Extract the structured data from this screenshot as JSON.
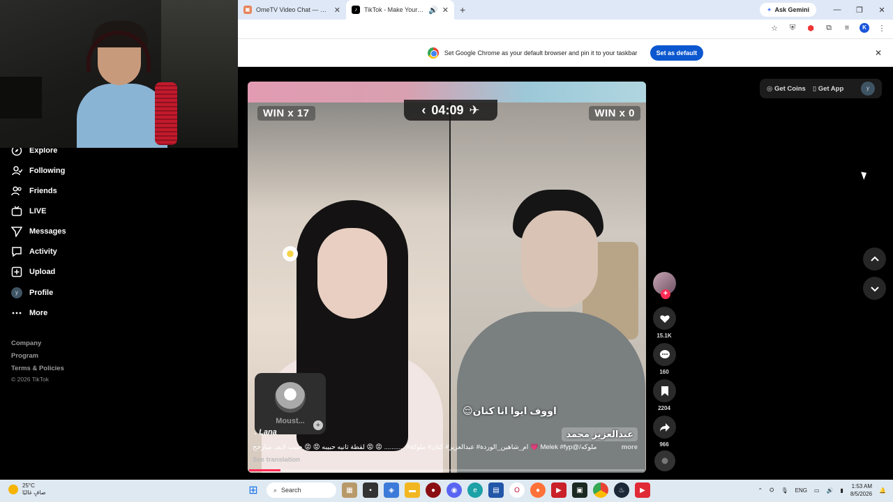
{
  "browser": {
    "tabs": [
      {
        "title": "OmeTV Video Chat — Omegle",
        "active": false
      },
      {
        "title": "TikTok - Make Your Day",
        "active": true
      }
    ],
    "ask_gemini": "Ask Gemini",
    "profile_initial": "K",
    "infobar_text": "Set Google Chrome as your default browser and pin it to your taskbar",
    "infobar_button": "Set as default"
  },
  "sidebar": {
    "items": [
      {
        "label": "Explore",
        "icon": "compass-icon"
      },
      {
        "label": "Following",
        "icon": "following-icon"
      },
      {
        "label": "Friends",
        "icon": "friends-icon"
      },
      {
        "label": "LIVE",
        "icon": "live-icon"
      },
      {
        "label": "Messages",
        "icon": "send-icon"
      },
      {
        "label": "Activity",
        "icon": "activity-icon"
      },
      {
        "label": "Upload",
        "icon": "upload-icon"
      },
      {
        "label": "Profile",
        "icon": "profile-avatar"
      },
      {
        "label": "More",
        "icon": "more-icon"
      }
    ],
    "profile_initial": "y",
    "footer": [
      "Company",
      "Program",
      "Terms & Policies"
    ],
    "copyright": "© 2026 TikTok"
  },
  "top_right": {
    "get_coins": "Get Coins",
    "get_app": "Get App",
    "avatar_initial": "y"
  },
  "video": {
    "win_left": "WIN x 17",
    "win_right": "WIN x 0",
    "timer": "04:09",
    "card_name": "Moust...",
    "caption_ar": "اووف ايوا انا كنان😌",
    "name_ar": "عبدالعزيز محمد",
    "author": ". Lana",
    "description": "ملوكه/@Melek #fyp 💗 ام_شاهين_الوردة# عبدالعزيز# كنان# ملوكة#............ 😡 😡 لقطة ثانيه حبيبه 😡 😡 حبيت لايف مبارحح",
    "more": "more",
    "see_translation": "See translation",
    "progress": 0.08
  },
  "actions": {
    "likes": "15.1K",
    "comments": "160",
    "saves": "2204",
    "shares": "966"
  },
  "taskbar": {
    "temperature": "25°C",
    "weather_desc": "صافٍ غالبًا",
    "search": "Search",
    "lang": "ENG",
    "time": "1:53 AM",
    "date": "8/5/2026"
  }
}
